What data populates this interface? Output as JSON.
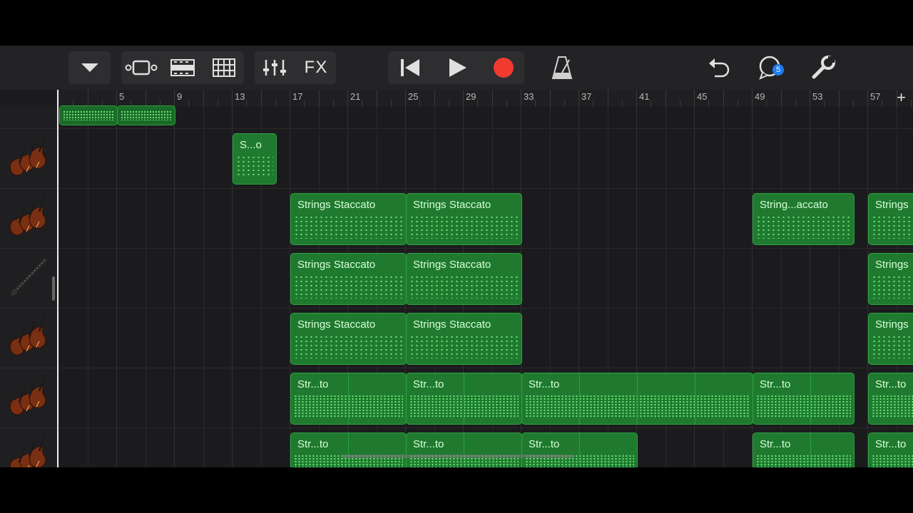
{
  "toolbar": {
    "fx_label": "FX",
    "loops_badge": "5"
  },
  "ruler": {
    "bar_numbers": [
      "5",
      "9",
      "13",
      "17",
      "21",
      "25",
      "29",
      "33",
      "37",
      "41",
      "45",
      "49",
      "53",
      "57"
    ],
    "add_label": "+"
  },
  "tracks": [
    {
      "instrument": "strings-partial",
      "regions": [
        "",
        ""
      ]
    },
    {
      "instrument": "violin",
      "regions": [
        "S...o"
      ]
    },
    {
      "instrument": "violin",
      "regions": [
        "Strings Staccato",
        "Strings Staccato",
        "String...accato",
        "Strings"
      ]
    },
    {
      "instrument": "clarinet",
      "regions": [
        "Strings Staccato",
        "Strings Staccato",
        "Strings"
      ]
    },
    {
      "instrument": "violin",
      "regions": [
        "Strings Staccato",
        "Strings Staccato",
        "Strings"
      ]
    },
    {
      "instrument": "violin",
      "regions": [
        "Str...to",
        "Str...to",
        "Str...to",
        "Str...to",
        "Str...to"
      ]
    },
    {
      "instrument": "violin",
      "regions": [
        "Str...to",
        "Str...to",
        "Str...to",
        "Str...to",
        "Str...to"
      ]
    }
  ],
  "colors": {
    "region_fill": "#1f7a2f",
    "record": "#f23b30",
    "badge": "#1e7cf2"
  },
  "icons": [
    "chevron-down-icon",
    "track-view-icon",
    "live-loops-icon",
    "grid-icon",
    "mixer-icon",
    "skip-back-icon",
    "play-icon",
    "record-icon",
    "metronome-icon",
    "undo-icon",
    "loops-icon",
    "settings-wrench-icon",
    "violin-icon",
    "clarinet-icon"
  ]
}
